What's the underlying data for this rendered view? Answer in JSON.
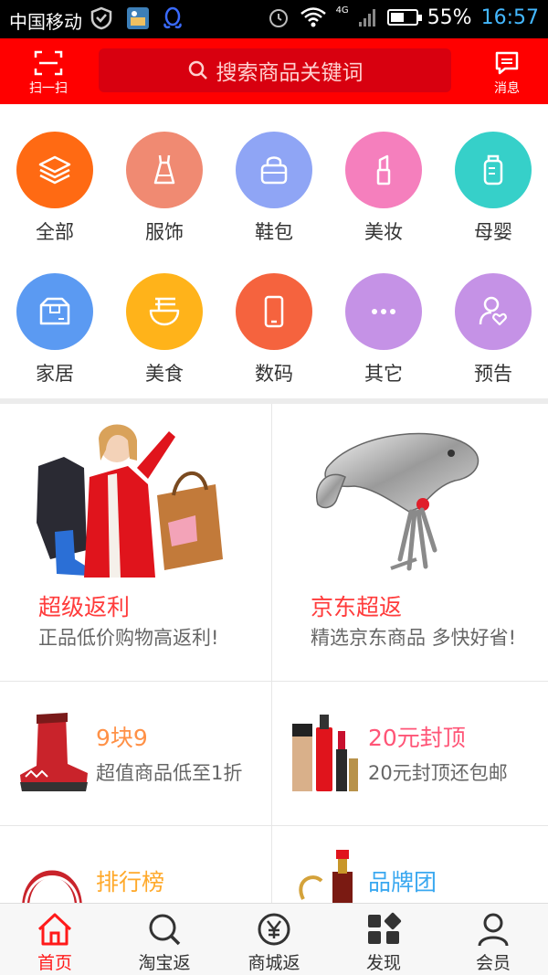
{
  "status_bar": {
    "carrier": "中国移动",
    "network": "4G",
    "battery": "55%",
    "battery_level": 0.55,
    "time": "16:57"
  },
  "header": {
    "scan_label": "扫一扫",
    "search_placeholder": "搜索商品关键词",
    "message_label": "消息",
    "bg_color": "#ff0000"
  },
  "categories": [
    {
      "label": "全部",
      "icon": "layers-icon",
      "color": "#ff6a13"
    },
    {
      "label": "服饰",
      "icon": "dress-icon",
      "color": "#f08a72"
    },
    {
      "label": "鞋包",
      "icon": "handbag-icon",
      "color": "#8fa5f5"
    },
    {
      "label": "美妆",
      "icon": "lipstick-icon",
      "color": "#f57fbd"
    },
    {
      "label": "母婴",
      "icon": "baby-bottle-icon",
      "color": "#36d0c9"
    },
    {
      "label": "家居",
      "icon": "box-icon",
      "color": "#5b9af2"
    },
    {
      "label": "美食",
      "icon": "noodle-bowl-icon",
      "color": "#ffb31a"
    },
    {
      "label": "数码",
      "icon": "phone-icon",
      "color": "#f5633e"
    },
    {
      "label": "其它",
      "icon": "more-dots-icon",
      "color": "#c592e6"
    },
    {
      "label": "预告",
      "icon": "user-heart-icon",
      "color": "#c592e6"
    }
  ],
  "promos": [
    {
      "title": "超级返利",
      "subtitle": "正品低价购物高返利!",
      "title_color": "#ff3b3b"
    },
    {
      "title": "京东超返",
      "subtitle": "精选京东商品 多快好省!",
      "title_color": "#ff3b3b"
    }
  ],
  "deals": [
    {
      "title": "9块9",
      "subtitle": "超值商品低至1折",
      "title_color": "#ff9147"
    },
    {
      "title": "20元封顶",
      "subtitle": "20元封顶还包邮",
      "title_color": "#ff5577"
    },
    {
      "title": "排行榜",
      "subtitle": "",
      "title_color": "#ffa92a"
    },
    {
      "title": "品牌团",
      "subtitle": "",
      "title_color": "#3aa8f0"
    }
  ],
  "tabs": [
    {
      "label": "首页",
      "icon": "home-icon",
      "active": true
    },
    {
      "label": "淘宝返",
      "icon": "search-icon",
      "active": false
    },
    {
      "label": "商城返",
      "icon": "yen-coin-icon",
      "active": false
    },
    {
      "label": "发现",
      "icon": "grid-discover-icon",
      "active": false
    },
    {
      "label": "会员",
      "icon": "user-icon",
      "active": false
    }
  ]
}
